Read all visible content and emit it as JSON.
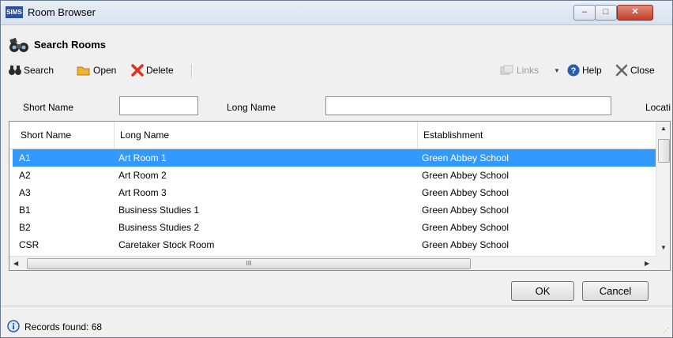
{
  "window": {
    "app_badge": "SIMS",
    "title": "Room Browser",
    "minimize": "‒",
    "maximize": "□",
    "close": "✕"
  },
  "heading": "Search Rooms",
  "toolbar": {
    "search": "Search",
    "open": "Open",
    "delete": "Delete",
    "links": "Links",
    "help": "Help",
    "close": "Close"
  },
  "filters": {
    "short_name_label": "Short Name",
    "short_name_value": "",
    "long_name_label": "Long Name",
    "long_name_value": "",
    "location_label": "Locati"
  },
  "grid": {
    "columns": [
      "Short Name",
      "Long Name",
      "Establishment"
    ],
    "rows": [
      {
        "short": "A1",
        "long": "Art Room 1",
        "est": "Green Abbey School",
        "selected": true
      },
      {
        "short": "A2",
        "long": "Art Room 2",
        "est": "Green Abbey School"
      },
      {
        "short": "A3",
        "long": "Art Room 3",
        "est": "Green Abbey School"
      },
      {
        "short": "B1",
        "long": "Business Studies 1",
        "est": "Green Abbey School"
      },
      {
        "short": "B2",
        "long": "Business Studies 2",
        "est": "Green Abbey School"
      },
      {
        "short": "CSR",
        "long": "Caretaker Stock Room",
        "est": "Green Abbey School"
      }
    ],
    "hthumb_grip": "III"
  },
  "buttons": {
    "ok": "OK",
    "cancel": "Cancel"
  },
  "status": {
    "text": "Records found: 68"
  },
  "colors": {
    "selection": "#3399ff",
    "help_icon": "#2a5db0",
    "delete_icon": "#e0301e",
    "open_icon": "#f2b233"
  }
}
